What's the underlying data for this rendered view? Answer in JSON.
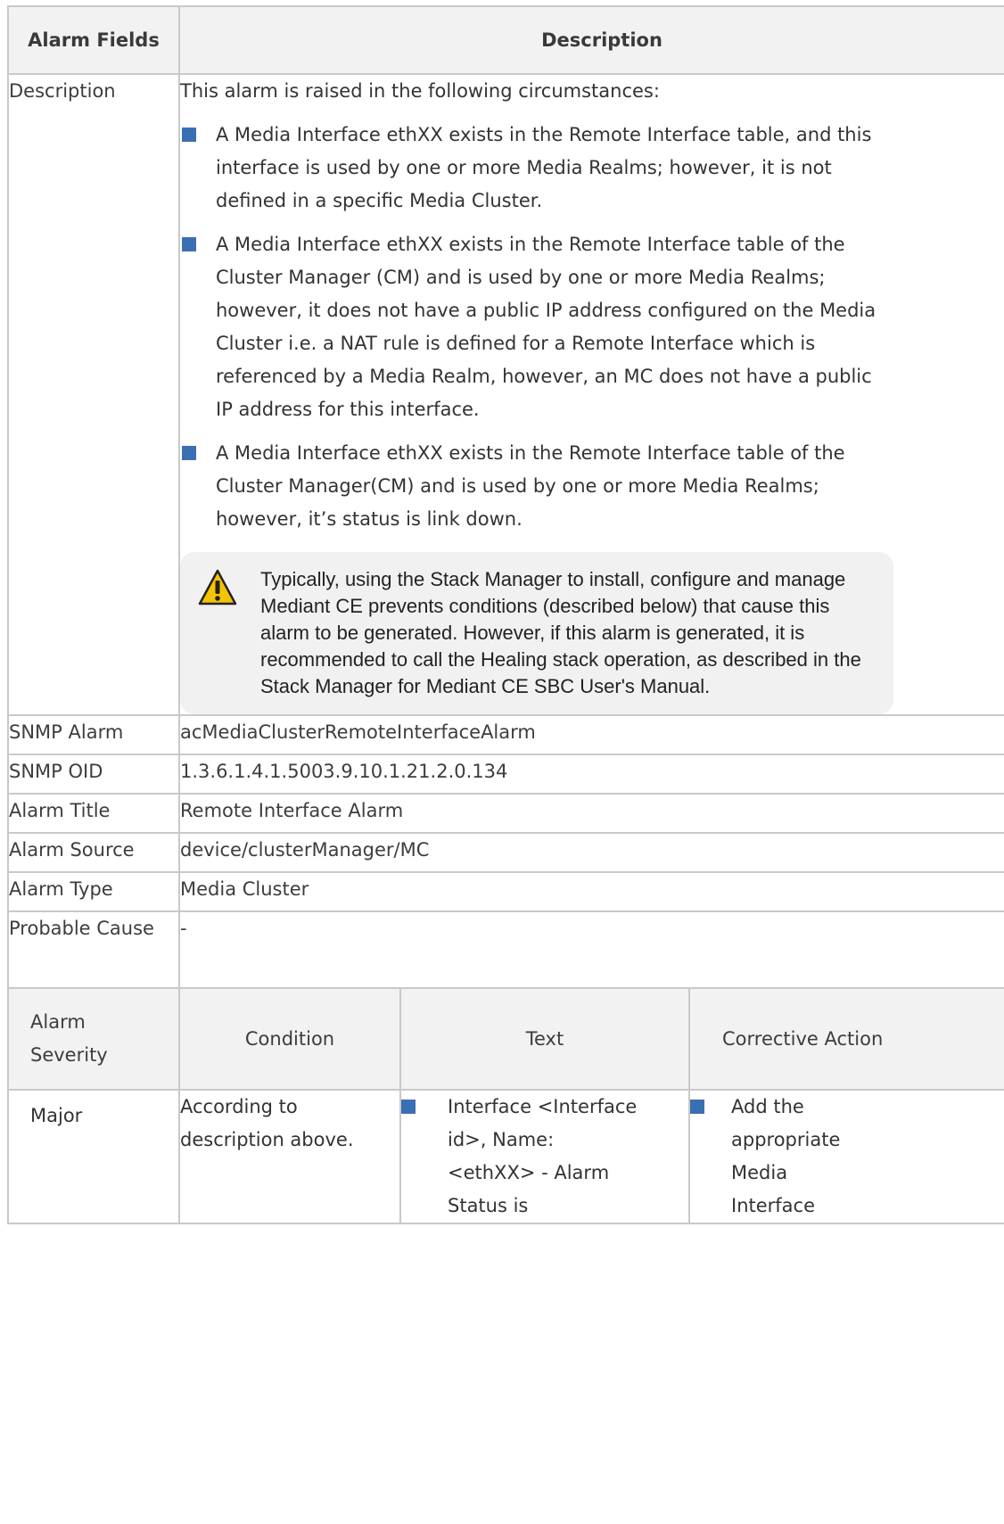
{
  "table": {
    "headers": {
      "field": "Alarm Fields",
      "description": "Description"
    },
    "description_row": {
      "field": "Description",
      "intro": "This alarm is raised in the following circumstances:",
      "bullets": [
        "A Media Interface ethXX exists in the Remote Interface table, and this interface is used by one or more Media Realms; however, it is not defined in a specific Media Cluster.",
        "A Media Interface ethXX exists in the Remote Interface table of the Cluster Manager (CM) and is used by one or more Media Realms; however, it does not have a public IP address configured on the Media Cluster i.e. a NAT rule is defined for a Remote Interface which is referenced by a Media Realm, however, an MC does not have a public IP address for this interface.",
        "A Media Interface ethXX exists in the Remote Interface table of the Cluster Manager(CM) and is used by one or more Media Realms; however, it’s status is link down."
      ],
      "note": "Typically, using the Stack Manager to install, configure and manage Mediant CE prevents conditions (described below) that cause this alarm to be generated. However, if this alarm is generated, it is recommended to call the Healing stack operation, as described in the Stack Manager for Mediant CE SBC User's Manual.",
      "note_icon": "warning-triangle-icon"
    },
    "rows": [
      {
        "field": "SNMP Alarm",
        "value": "acMediaClusterRemoteInterfaceAlarm"
      },
      {
        "field": "SNMP OID",
        "value": "1.3.6.1.4.1.5003.9.10.1.21.2.0.134"
      },
      {
        "field": "Alarm Title",
        "value": "Remote Interface Alarm"
      },
      {
        "field": "Alarm Source",
        "value": "device/clusterManager/MC"
      },
      {
        "field": "Alarm Type",
        "value": "Media Cluster"
      },
      {
        "field": "Probable Cause",
        "value": "-"
      }
    ],
    "severity_header": {
      "severity": "Alarm Severity",
      "condition": "Condition",
      "text": "Text",
      "action": "Corrective Action"
    },
    "severity_rows": [
      {
        "severity": "Major",
        "condition": "According to description above.",
        "text": "Interface <Interface id>, Name: <ethXX> - Alarm Status is",
        "action": "Add the appropriate Media Interface"
      }
    ]
  },
  "colors": {
    "bullet": "#3b6fb3",
    "header_bg": "#f2f2f2",
    "border": "#c9c9c9",
    "note_bg": "#f1f1f1",
    "warning_yellow": "#f5c400"
  }
}
